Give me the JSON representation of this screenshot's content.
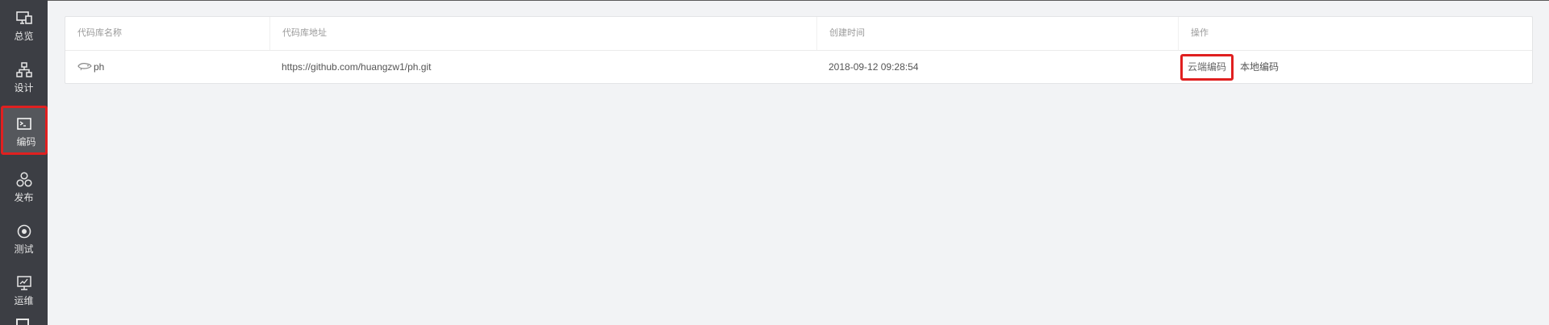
{
  "sidebar": {
    "items": [
      {
        "label": "总览",
        "icon": "monitor-icon"
      },
      {
        "label": "设计",
        "icon": "sitemap-icon"
      },
      {
        "label": "编码",
        "icon": "terminal-icon",
        "active": true
      },
      {
        "label": "发布",
        "icon": "cluster-icon"
      },
      {
        "label": "测试",
        "icon": "target-icon"
      },
      {
        "label": "运维",
        "icon": "monitor-chart-icon"
      }
    ]
  },
  "table": {
    "columns": [
      "代码库名称",
      "代码库地址",
      "创建时间",
      "操作"
    ],
    "rows": [
      {
        "name": "ph",
        "url": "https://github.com/huangzw1/ph.git",
        "created": "2018-09-12 09:28:54",
        "actions": [
          "云端编码",
          "本地编码"
        ]
      }
    ]
  },
  "colors": {
    "sidebar_bg": "#3c3e44",
    "highlight": "#e02020",
    "page_bg": "#f2f3f5"
  }
}
